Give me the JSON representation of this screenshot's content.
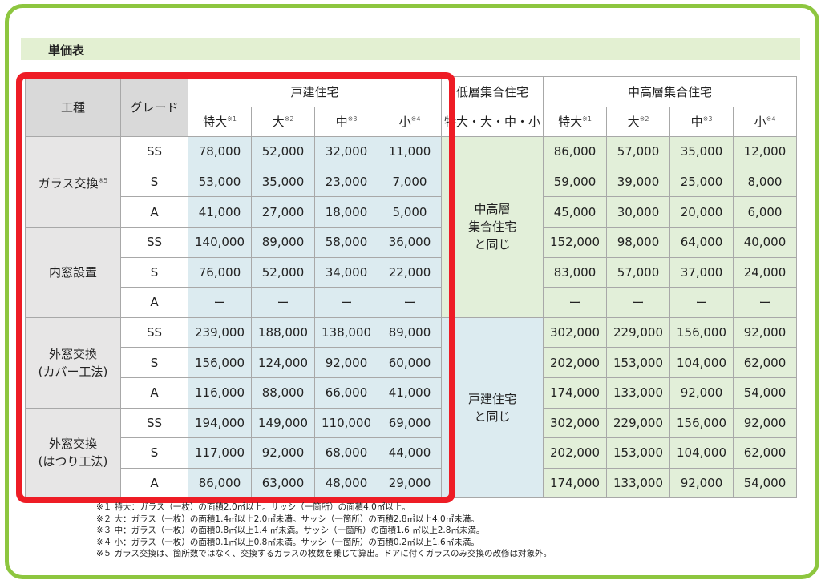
{
  "title": "単価表",
  "headers": {
    "work_type": "工種",
    "grade": "グレード",
    "detached": "戸建住宅",
    "low_rise": "低層集合住宅",
    "mid_high_rise": "中高層集合住宅",
    "low_rise_sizes": "特大・大・中・小",
    "sizes": [
      {
        "label": "特大",
        "mark": "※1"
      },
      {
        "label": "大",
        "mark": "※2"
      },
      {
        "label": "中",
        "mark": "※3"
      },
      {
        "label": "小",
        "mark": "※4"
      }
    ]
  },
  "merged": {
    "low_rise_upper": "中高層\n集合住宅\nと同じ",
    "low_rise_lower": "戸建住宅\nと同じ"
  },
  "groups": [
    {
      "name": "ガラス交換",
      "mark": "※5",
      "rows": [
        {
          "grade": "SS",
          "detached": [
            "78,000",
            "52,000",
            "32,000",
            "11,000"
          ],
          "mid": [
            "86,000",
            "57,000",
            "35,000",
            "12,000"
          ]
        },
        {
          "grade": "S",
          "detached": [
            "53,000",
            "35,000",
            "23,000",
            "7,000"
          ],
          "mid": [
            "59,000",
            "39,000",
            "25,000",
            "8,000"
          ]
        },
        {
          "grade": "A",
          "detached": [
            "41,000",
            "27,000",
            "18,000",
            "5,000"
          ],
          "mid": [
            "45,000",
            "30,000",
            "20,000",
            "6,000"
          ]
        }
      ]
    },
    {
      "name": "内窓設置",
      "mark": "",
      "rows": [
        {
          "grade": "SS",
          "detached": [
            "140,000",
            "89,000",
            "58,000",
            "36,000"
          ],
          "mid": [
            "152,000",
            "98,000",
            "64,000",
            "40,000"
          ]
        },
        {
          "grade": "S",
          "detached": [
            "76,000",
            "52,000",
            "34,000",
            "22,000"
          ],
          "mid": [
            "83,000",
            "57,000",
            "37,000",
            "24,000"
          ]
        },
        {
          "grade": "A",
          "detached": [
            "ー",
            "ー",
            "ー",
            "ー"
          ],
          "mid": [
            "ー",
            "ー",
            "ー",
            "ー"
          ]
        }
      ]
    },
    {
      "name": "外窓交換\n(カバー工法)",
      "mark": "",
      "rows": [
        {
          "grade": "SS",
          "detached": [
            "239,000",
            "188,000",
            "138,000",
            "89,000"
          ],
          "mid": [
            "302,000",
            "229,000",
            "156,000",
            "92,000"
          ]
        },
        {
          "grade": "S",
          "detached": [
            "156,000",
            "124,000",
            "92,000",
            "60,000"
          ],
          "mid": [
            "202,000",
            "153,000",
            "104,000",
            "62,000"
          ]
        },
        {
          "grade": "A",
          "detached": [
            "116,000",
            "88,000",
            "66,000",
            "41,000"
          ],
          "mid": [
            "174,000",
            "133,000",
            "92,000",
            "54,000"
          ]
        }
      ]
    },
    {
      "name": "外窓交換\n(はつり工法)",
      "mark": "",
      "rows": [
        {
          "grade": "SS",
          "detached": [
            "194,000",
            "149,000",
            "110,000",
            "69,000"
          ],
          "mid": [
            "302,000",
            "229,000",
            "156,000",
            "92,000"
          ]
        },
        {
          "grade": "S",
          "detached": [
            "117,000",
            "92,000",
            "68,000",
            "44,000"
          ],
          "mid": [
            "202,000",
            "153,000",
            "104,000",
            "62,000"
          ]
        },
        {
          "grade": "A",
          "detached": [
            "86,000",
            "63,000",
            "48,000",
            "29,000"
          ],
          "mid": [
            "174,000",
            "133,000",
            "92,000",
            "54,000"
          ]
        }
      ]
    }
  ],
  "footnotes": [
    "※１ 特大：ガラス（一枚）の面積2.0㎡以上。サッシ（一箇所）の面積4.0㎡以上。",
    "※２ 大：ガラス（一枚）の面積1.4㎡以上2.0㎡未満。サッシ（一箇所）の面積2.8㎡以上4.0㎡未満。",
    "※３ 中：ガラス（一枚）の面積0.8㎡以上1.4 ㎡未満。サッシ（一箇所）の面積1.6 ㎡以上2.8㎡未満。",
    "※４ 小：ガラス（一枚）の面積0.1㎡以上0.8㎡未満。サッシ（一箇所）の面積0.2㎡以上1.6㎡未満。",
    "※５ ガラス交換は、箇所数ではなく、交換するガラスの枚数を乗じて算出。ドアに付くガラスのみ交換の改修は対象外。"
  ],
  "colors": {
    "frame": "#8dc63f",
    "title_bar": "#e3f0d2",
    "highlight_box": "#ee1c25",
    "detached_cells": "#dcebf0",
    "mid_high_cells": "#e2efd9",
    "header_gray": "#d9d9d9"
  }
}
